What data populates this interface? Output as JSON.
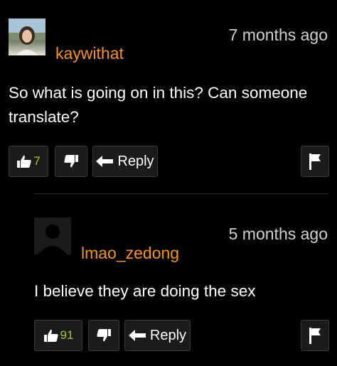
{
  "comments": [
    {
      "username": "kaywithat",
      "timestamp": "7 months ago",
      "text": "So what is going on in this? Can someone translate?",
      "likes": "7",
      "reply_label": "Reply"
    },
    {
      "username": "lmao_zedong",
      "timestamp": "5 months ago",
      "text": "I believe they are doing the sex",
      "likes": "91",
      "reply_label": "Reply"
    }
  ],
  "colors": {
    "background": "#000000",
    "username": "#f7931e",
    "like_count": "#9ccf22",
    "button_bg": "#1b1b1b"
  },
  "icons": [
    "thumbs-up-icon",
    "thumbs-down-icon",
    "reply-arrow-icon",
    "flag-icon"
  ]
}
